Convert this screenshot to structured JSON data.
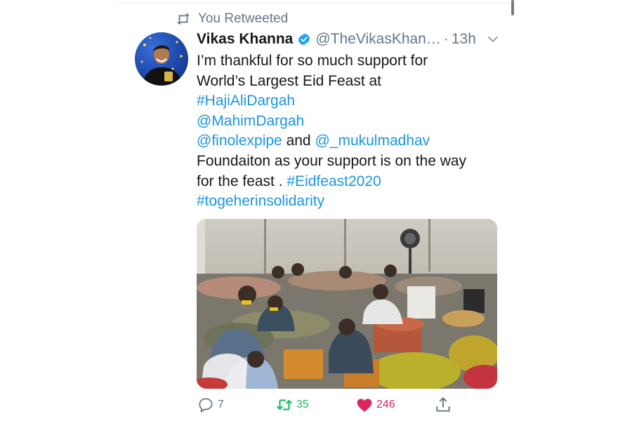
{
  "retweet_context": {
    "label": "You Retweeted"
  },
  "author": {
    "display_name": "Vikas Khanna",
    "handle": "@TheVikasKhan…",
    "separator": "·",
    "time": "13h"
  },
  "tweet": {
    "lines": [
      [
        {
          "text": "I’m thankful for so much support for",
          "type": "text"
        }
      ],
      [
        {
          "text": "World’s Largest Eid Feast at",
          "type": "text"
        }
      ],
      [
        {
          "text": "#HajiAliDargah",
          "type": "hashtag"
        }
      ],
      [
        {
          "text": "@MahimDargah",
          "type": "mention"
        }
      ],
      [
        {
          "text": "@finolexpipe",
          "type": "mention"
        },
        {
          "text": " and ",
          "type": "text"
        },
        {
          "text": "@_mukulmadhav",
          "type": "mention"
        }
      ],
      [
        {
          "text": "Foundaiton as your support is on the way",
          "type": "text"
        }
      ],
      [
        {
          "text": "for the feast . ",
          "type": "text"
        },
        {
          "text": "#Eidfeast2020",
          "type": "hashtag"
        }
      ],
      [
        {
          "text": "#togeherinsolidarity",
          "type": "hashtag"
        }
      ]
    ]
  },
  "actions": {
    "reply_count": "7",
    "retweet_count": "35",
    "like_count": "246"
  },
  "colors": {
    "link": "#1b95e0",
    "retweet_green": "#17bf63",
    "like_red": "#e0245e",
    "muted": "#657786",
    "verified_blue": "#1da1f2"
  },
  "icons": [
    "retweet-icon",
    "verified-badge-icon",
    "chevron-down-icon",
    "reply-icon",
    "retweet-icon",
    "heart-icon",
    "share-icon"
  ]
}
